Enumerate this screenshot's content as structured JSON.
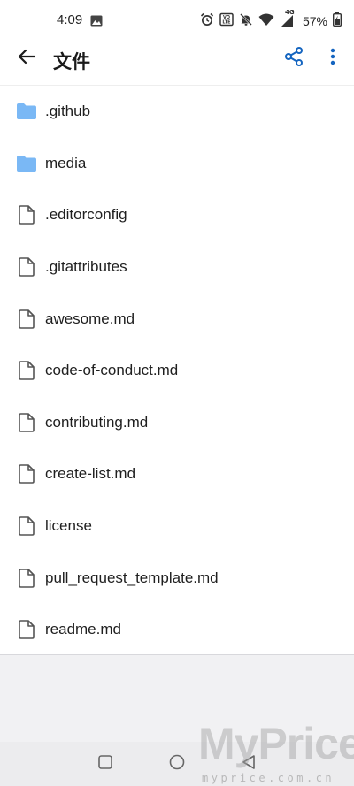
{
  "status_bar": {
    "time": "4:09",
    "battery_percent": "57%",
    "network_type": "4G",
    "icons": [
      "gallery-icon",
      "alarm-icon",
      "volte-icon",
      "mute-icon",
      "wifi-icon",
      "signal-icon",
      "battery-charging-icon"
    ]
  },
  "app_bar": {
    "title": "文件",
    "back_icon": "arrow-left-icon",
    "share_icon": "share-icon",
    "more_icon": "more-vertical-icon",
    "accent_color": "#1565c0"
  },
  "files": [
    {
      "name": ".github",
      "type": "folder"
    },
    {
      "name": "media",
      "type": "folder"
    },
    {
      "name": ".editorconfig",
      "type": "file"
    },
    {
      "name": ".gitattributes",
      "type": "file"
    },
    {
      "name": "awesome.md",
      "type": "file"
    },
    {
      "name": "code-of-conduct.md",
      "type": "file"
    },
    {
      "name": "contributing.md",
      "type": "file"
    },
    {
      "name": "create-list.md",
      "type": "file"
    },
    {
      "name": "license",
      "type": "file"
    },
    {
      "name": "pull_request_template.md",
      "type": "file"
    },
    {
      "name": "readme.md",
      "type": "file"
    }
  ],
  "colors": {
    "folder": "#7ab8f5",
    "file_outline": "#555555",
    "background": "#ffffff",
    "empty_area": "#f1f1f3",
    "nav_bar": "#ececee"
  },
  "nav_bar": {
    "icons": [
      "recents-square-icon",
      "home-circle-icon",
      "back-triangle-icon"
    ]
  },
  "watermark": {
    "logo": "MyPrice",
    "url": "myprice.com.cn"
  }
}
